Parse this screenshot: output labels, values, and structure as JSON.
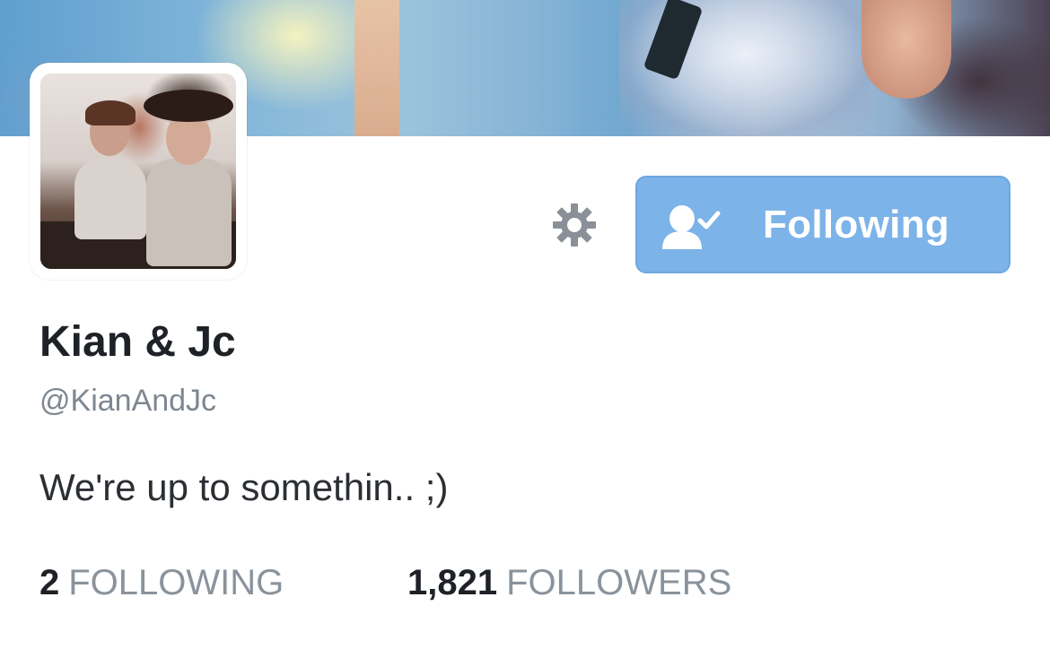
{
  "profile": {
    "display_name": "Kian & Jc",
    "handle": "@KianAndJc",
    "bio": "We're up to somethin.. ;)",
    "follow_button_label": "Following",
    "stats": {
      "following_count": "2",
      "following_label": "FOLLOWING",
      "followers_count": "1,821",
      "followers_label": "FOLLOWERS"
    }
  },
  "icons": {
    "settings": "gear-icon",
    "follow_state": "person-check-icon"
  },
  "colors": {
    "accent": "#7cb3e8",
    "text_primary": "#1e2227",
    "text_secondary": "#7d8791",
    "icon_gray": "#8a9097"
  }
}
